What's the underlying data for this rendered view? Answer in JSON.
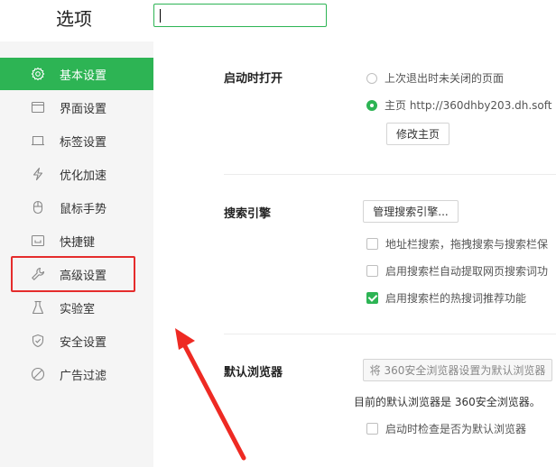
{
  "header": {
    "title": "选项",
    "search_value": ""
  },
  "sidebar": {
    "items": [
      {
        "label": "基本设置",
        "icon": "gear-icon",
        "active": true
      },
      {
        "label": "界面设置",
        "icon": "window-icon",
        "active": false
      },
      {
        "label": "标签设置",
        "icon": "tab-icon",
        "active": false
      },
      {
        "label": "优化加速",
        "icon": "lightning-icon",
        "active": false
      },
      {
        "label": "鼠标手势",
        "icon": "mouse-icon",
        "active": false
      },
      {
        "label": "快捷键",
        "icon": "keyboard-icon",
        "active": false
      },
      {
        "label": "高级设置",
        "icon": "wrench-icon",
        "active": false
      },
      {
        "label": "实验室",
        "icon": "flask-icon",
        "active": false
      },
      {
        "label": "安全设置",
        "icon": "shield-icon",
        "active": false
      },
      {
        "label": "广告过滤",
        "icon": "block-icon",
        "active": false
      }
    ]
  },
  "startup": {
    "title": "启动时打开",
    "option_restore": "上次退出时未关闭的页面",
    "option_home": "主页  http://360dhby203.dh.soft",
    "edit_home_button": "修改主页"
  },
  "search_engine": {
    "title": "搜索引擎",
    "manage_button": "管理搜索引擎...",
    "opt1": "地址栏搜索，拖拽搜索与搜索栏保",
    "opt2": "启用搜索栏自动提取网页搜索词功",
    "opt3": "启用搜索栏的热搜词推荐功能",
    "opt1_checked": false,
    "opt2_checked": false,
    "opt3_checked": true
  },
  "default_browser": {
    "title": "默认浏览器",
    "set_default_button": "将 360安全浏览器设置为默认浏览器",
    "status_text": "目前的默认浏览器是 360安全浏览器。",
    "check_on_start": "启动时检查是否为默认浏览器"
  },
  "colors": {
    "accent": "#2db454",
    "highlight": "#e52c2c"
  }
}
